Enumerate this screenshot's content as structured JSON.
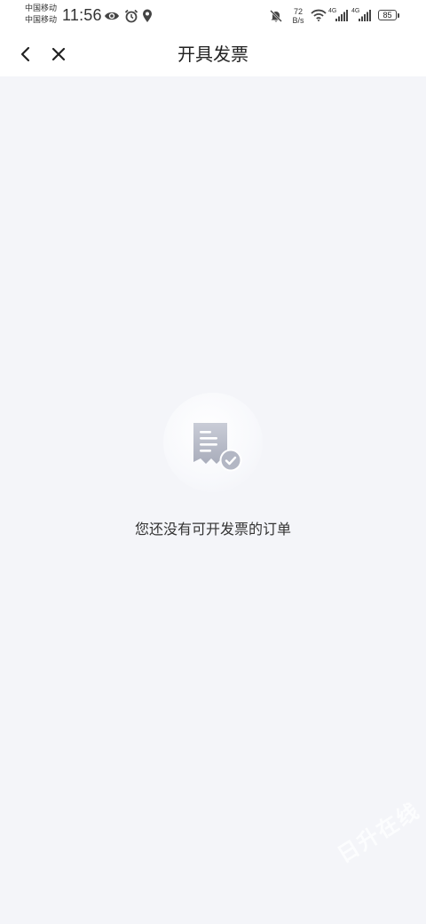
{
  "status_bar": {
    "carrier_1": "中国移动",
    "carrier_2": "中国移动",
    "time": "11:56",
    "net_speed_value": "72",
    "net_speed_unit": "B/s",
    "signal_1_label": "4G",
    "signal_2_label": "4G",
    "battery_level": "85",
    "icons": [
      "eye-icon",
      "alarm-icon",
      "location-icon",
      "bell-muted-icon",
      "wifi-icon",
      "signal-icon",
      "signal-icon",
      "battery-icon"
    ]
  },
  "nav": {
    "title": "开具发票",
    "back_icon": "chevron-left-icon",
    "close_icon": "close-icon"
  },
  "empty_state": {
    "icon": "invoice-check-icon",
    "message": "您还没有可开发票的订单"
  },
  "watermark": {
    "text": "日升在线"
  },
  "colors": {
    "page_background": "#f4f5f9",
    "bar_background": "#ffffff",
    "icon_gray": "#b3b7c4"
  }
}
